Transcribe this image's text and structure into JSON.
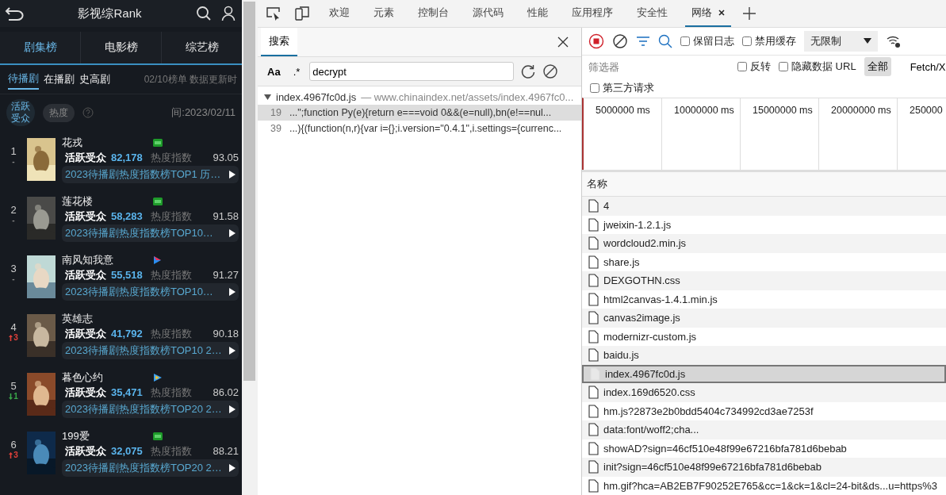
{
  "app": {
    "title": "影视综Rank",
    "categories": [
      {
        "label": "剧集榜",
        "selected": true
      },
      {
        "label": "电影榜",
        "selected": false
      },
      {
        "label": "综艺榜",
        "selected": false
      }
    ],
    "subtabs": [
      {
        "label": "待播剧",
        "selected": true
      },
      {
        "label": "在播剧",
        "selected": false
      },
      {
        "label": "史高剧",
        "selected": false
      }
    ],
    "update_note": "02/10榜单 数据更新时",
    "metrics": [
      {
        "label": "活跃受众",
        "selected": true
      },
      {
        "label": "热度",
        "selected": false
      }
    ],
    "update_date": "间:2023/02/11",
    "items": [
      {
        "rank": "1",
        "change": {
          "kind": "same",
          "text": "-"
        },
        "title": "花戎",
        "platform": {
          "kind": "iqiyi"
        },
        "audience_label": "活跃受众",
        "audience": "82,178",
        "heat_label": "热度指数",
        "heat": "93.05",
        "note": "2023待播剧热度指数榜TOP1  历…"
      },
      {
        "rank": "2",
        "change": {
          "kind": "same",
          "text": "-"
        },
        "title": "莲花楼",
        "platform": {
          "kind": "iqiyi"
        },
        "audience_label": "活跃受众",
        "audience": "58,283",
        "heat_label": "热度指数",
        "heat": "91.58",
        "note": "2023待播剧热度指数榜TOP10…"
      },
      {
        "rank": "3",
        "change": {
          "kind": "same",
          "text": "-"
        },
        "title": "南风知我意",
        "platform": {
          "kind": "youku"
        },
        "audience_label": "活跃受众",
        "audience": "55,518",
        "heat_label": "热度指数",
        "heat": "91.27",
        "note": "2023待播剧热度指数榜TOP10…"
      },
      {
        "rank": "4",
        "change": {
          "kind": "up",
          "text": "3"
        },
        "title": "英雄志",
        "audience_label": "活跃受众",
        "audience": "41,792",
        "heat_label": "热度指数",
        "heat": "90.18",
        "note": "2023待播剧热度指数榜TOP10  2…"
      },
      {
        "rank": "5",
        "change": {
          "kind": "down",
          "text": "1"
        },
        "title": "暮色心约",
        "platform": {
          "kind": "tencent"
        },
        "audience_label": "活跃受众",
        "audience": "35,471",
        "heat_label": "热度指数",
        "heat": "86.02",
        "note": "2023待播剧热度指数榜TOP20  2…"
      },
      {
        "rank": "6",
        "change": {
          "kind": "up",
          "text": "3"
        },
        "title": "199爱",
        "platform": {
          "kind": "iqiyi"
        },
        "audience_label": "活跃受众",
        "audience": "32,075",
        "heat_label": "热度指数",
        "heat": "88.21",
        "note": "2023待播剧热度指数榜TOP20  2…"
      }
    ]
  },
  "devtools": {
    "tabs": [
      {
        "label": "欢迎",
        "selected": false,
        "closable": false
      },
      {
        "label": "元素",
        "selected": false,
        "closable": false
      },
      {
        "label": "控制台",
        "selected": false,
        "closable": false
      },
      {
        "label": "源代码",
        "selected": false,
        "closable": false
      },
      {
        "label": "性能",
        "selected": false,
        "closable": false
      },
      {
        "label": "应用程序",
        "selected": false,
        "closable": false
      },
      {
        "label": "安全性",
        "selected": false,
        "closable": false
      },
      {
        "label": "网络",
        "selected": true,
        "closable": true
      }
    ],
    "search": {
      "tab": "搜索",
      "case_label": "Aa",
      "regex_label": ".*",
      "query": "decrypt",
      "results": [
        {
          "file": "index.4967fc0d.js",
          "url": "— www.chinaindex.net/assets/index.4967fc0...",
          "expanded": true,
          "matches": [
            {
              "line": "19",
              "text": "...\";function Py(e){return e===void 0&&(e=null),bn(e!==nul...",
              "selected": true
            },
            {
              "line": "39",
              "text": "...){(function(n,r){var i={};i.version=\"0.4.1\",i.settings={currenc...",
              "selected": false
            }
          ]
        }
      ]
    },
    "network": {
      "preserve_log": {
        "label": "保留日志",
        "checked": false
      },
      "disable_cache": {
        "label": "禁用缓存",
        "checked": false
      },
      "throttle": "无限制",
      "filter_placeholder": "筛选器",
      "invert": {
        "label": "反转",
        "checked": false
      },
      "hide_data_urls": {
        "label": "隐藏数据 URL",
        "checked": false
      },
      "types": [
        {
          "label": "全部",
          "selected": true
        },
        {
          "label": "Fetch/X",
          "selected": false
        }
      ],
      "third_party": {
        "label": "第三方请求",
        "checked": false
      },
      "timeline_ticks": [
        "5000000 ms",
        "10000000 ms",
        "15000000 ms",
        "20000000 ms",
        "250000"
      ],
      "column": "名称",
      "requests": [
        {
          "name": "4",
          "selected": false
        },
        {
          "name": "jweixin-1.2.1.js",
          "selected": false
        },
        {
          "name": "wordcloud2.min.js",
          "selected": false
        },
        {
          "name": "share.js",
          "selected": false
        },
        {
          "name": "DEXGOTHN.css",
          "selected": false
        },
        {
          "name": "html2canvas-1.4.1.min.js",
          "selected": false
        },
        {
          "name": "canvas2image.js",
          "selected": false
        },
        {
          "name": "modernizr-custom.js",
          "selected": false
        },
        {
          "name": "baidu.js",
          "selected": false
        },
        {
          "name": "index.4967fc0d.js",
          "selected": true
        },
        {
          "name": "index.169d6520.css",
          "selected": false
        },
        {
          "name": "hm.js?2873e2b0bdd5404c734992cd3ae7253f",
          "selected": false
        },
        {
          "name": "data:font/woff2;cha...",
          "selected": false
        },
        {
          "name": "showAD?sign=46cf510e48f99e67216bfa781d6bebab",
          "selected": false
        },
        {
          "name": "init?sign=46cf510e48f99e67216bfa781d6bebab",
          "selected": false
        },
        {
          "name": "hm.gif?hca=AB2EB7F90252E765&cc=1&ck=1&cl=24-bit&ds...u=https%3",
          "selected": false
        }
      ]
    }
  }
}
